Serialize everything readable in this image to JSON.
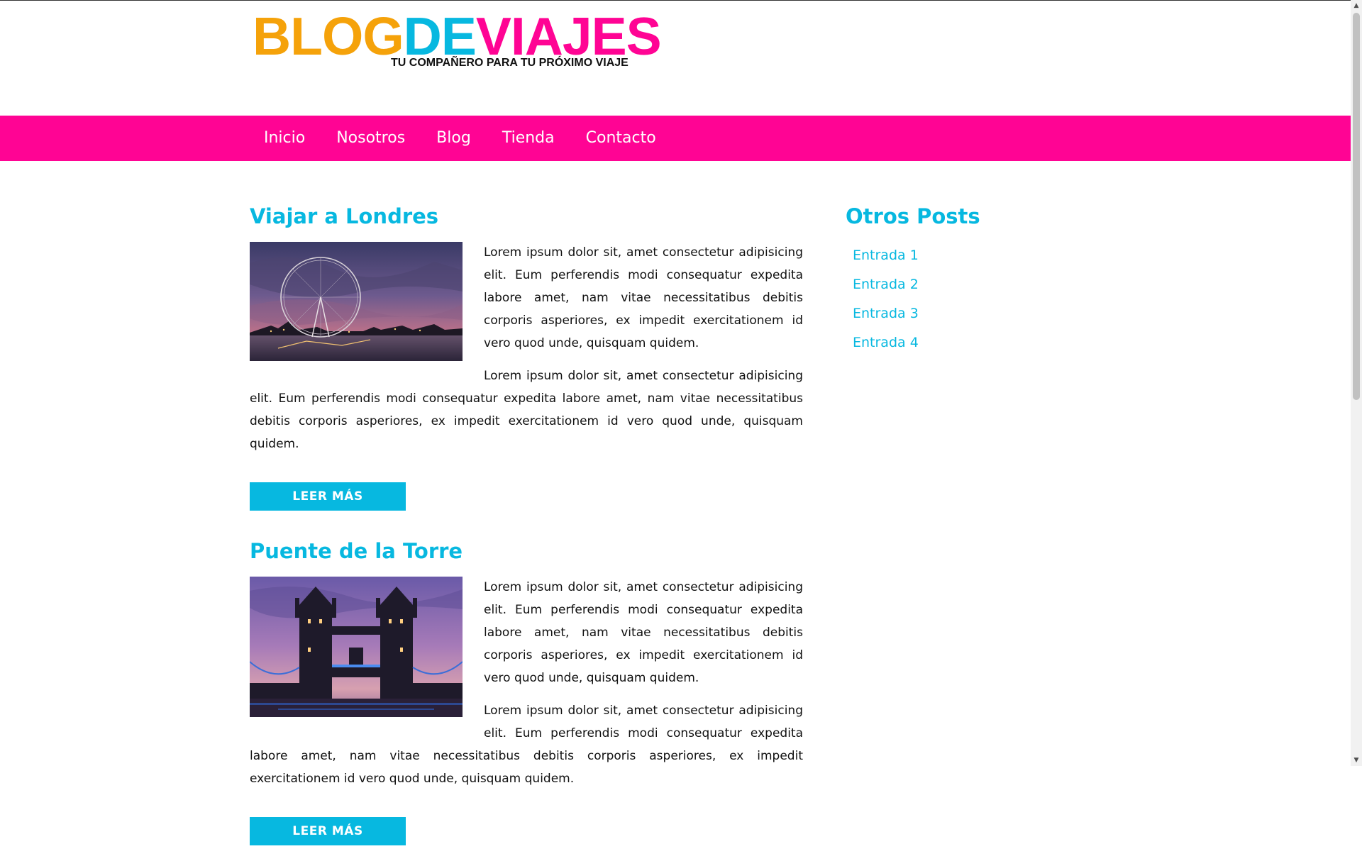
{
  "colors": {
    "orange": "#f5a20a",
    "cyan": "#07b8e0",
    "pink": "#ff0494",
    "dark": "#111111",
    "background": "#ffffff"
  },
  "logo": {
    "part1": "BLOG",
    "part2": "DE",
    "part3": "VIAJES",
    "tagline": "TU COMPAÑERO PARA TU PRÓXIMO VIAJE"
  },
  "nav": {
    "items": [
      {
        "label": "Inicio"
      },
      {
        "label": "Nosotros"
      },
      {
        "label": "Blog"
      },
      {
        "label": "Tienda"
      },
      {
        "label": "Contacto"
      }
    ]
  },
  "posts": [
    {
      "title": "Viajar a Londres",
      "image_icon": "london-eye-photo",
      "paragraphs": [
        "Lorem ipsum dolor sit, amet consectetur adipisicing elit. Eum perferendis modi consequatur expedita labore amet, nam vitae necessitatibus debitis corporis asperiores, ex impedit exercitationem id vero quod unde, quisquam quidem.",
        "Lorem ipsum dolor sit, amet consectetur adipisicing elit. Eum perferendis modi consequatur expedita labore amet, nam vitae necessitatibus debitis corporis asperiores, ex impedit exercitationem id vero quod unde, quisquam quidem."
      ],
      "button": "LEER MÁS"
    },
    {
      "title": "Puente de la Torre",
      "image_icon": "tower-bridge-photo",
      "paragraphs": [
        "Lorem ipsum dolor sit, amet consectetur adipisicing elit. Eum perferendis modi consequatur expedita labore amet, nam vitae necessitatibus debitis corporis asperiores, ex impedit exercitationem id vero quod unde, quisquam quidem.",
        "Lorem ipsum dolor sit, amet consectetur adipisicing elit. Eum perferendis modi consequatur expedita labore amet, nam vitae necessitatibus debitis corporis asperiores, ex impedit exercitationem id vero quod unde, quisquam quidem."
      ],
      "button": "LEER MÁS"
    }
  ],
  "sidebar": {
    "title": "Otros Posts",
    "items": [
      {
        "label": "Entrada 1"
      },
      {
        "label": "Entrada 2"
      },
      {
        "label": "Entrada 3"
      },
      {
        "label": "Entrada 4"
      }
    ]
  }
}
